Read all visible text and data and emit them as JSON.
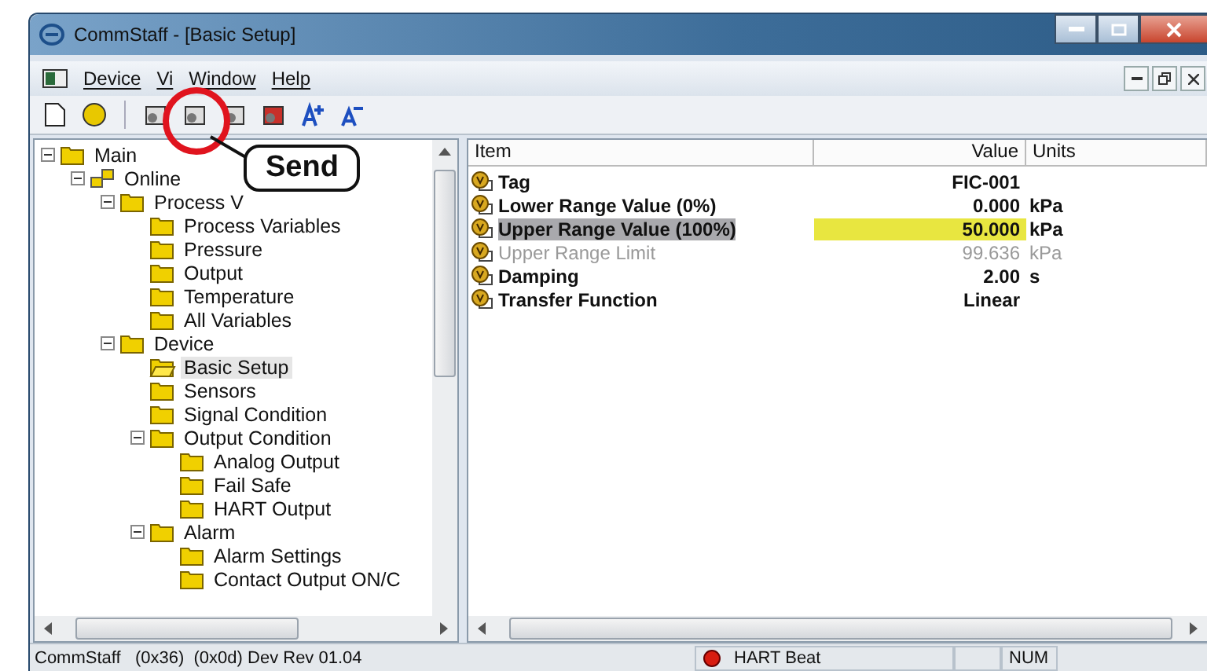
{
  "window": {
    "title": "CommStaff - [Basic Setup]"
  },
  "menu": [
    {
      "label": "Device"
    },
    {
      "label": "Vi"
    },
    {
      "label": "Window"
    },
    {
      "label": "Help"
    }
  ],
  "callout": {
    "label": "Send"
  },
  "tree": [
    {
      "label": "Main",
      "expanded": true,
      "kind": "folder",
      "selected": false,
      "children": [
        {
          "label": "Online",
          "expanded": true,
          "kind": "network",
          "selected": false,
          "children": [
            {
              "label": "Process V",
              "expanded": true,
              "kind": "folder",
              "selected": false,
              "children": [
                {
                  "label": "Process Variables",
                  "kind": "folder",
                  "selected": false
                },
                {
                  "label": "Pressure",
                  "kind": "folder",
                  "selected": false
                },
                {
                  "label": "Output",
                  "kind": "folder",
                  "selected": false
                },
                {
                  "label": "Temperature",
                  "kind": "folder",
                  "selected": false
                },
                {
                  "label": "All Variables",
                  "kind": "folder",
                  "selected": false
                }
              ]
            },
            {
              "label": "Device",
              "expanded": true,
              "kind": "folder",
              "selected": false,
              "children": [
                {
                  "label": "Basic Setup",
                  "kind": "folder",
                  "selected": true
                },
                {
                  "label": "Sensors",
                  "kind": "folder",
                  "selected": false
                },
                {
                  "label": "Signal Condition",
                  "kind": "folder",
                  "selected": false
                },
                {
                  "label": "Output Condition",
                  "expanded": true,
                  "kind": "folder",
                  "selected": false,
                  "children": [
                    {
                      "label": "Analog Output",
                      "kind": "folder",
                      "selected": false
                    },
                    {
                      "label": "Fail Safe",
                      "kind": "folder",
                      "selected": false
                    },
                    {
                      "label": "HART Output",
                      "kind": "folder",
                      "selected": false
                    }
                  ]
                },
                {
                  "label": "Alarm",
                  "expanded": true,
                  "kind": "folder",
                  "selected": false,
                  "children": [
                    {
                      "label": "Alarm Settings",
                      "kind": "folder",
                      "selected": false
                    },
                    {
                      "label": "Contact Output ON/C",
                      "kind": "folder",
                      "selected": false
                    }
                  ]
                }
              ]
            }
          ]
        }
      ]
    }
  ],
  "table": {
    "columns": [
      "Item",
      "Value",
      "Units"
    ],
    "rows": [
      {
        "item": "Tag",
        "value": "FIC-001",
        "selected": false,
        "disabled": false
      },
      {
        "item": "Lower Range Value (0%)",
        "value": "0.000",
        "units": "kPa",
        "selected": false,
        "disabled": false
      },
      {
        "item": "Upper Range Value (100%)",
        "value": "50.000",
        "units": "kPa",
        "selected": true,
        "disabled": false
      },
      {
        "item": "Upper Range Limit",
        "value": "99.636",
        "units": "kPa",
        "selected": false,
        "disabled": true
      },
      {
        "item": "Damping",
        "value": "2.00",
        "units": "s",
        "selected": false,
        "disabled": false
      },
      {
        "item": "Transfer Function",
        "value": "Linear",
        "selected": false,
        "disabled": false
      }
    ]
  },
  "status_bar": {
    "left": "CommStaff   (0x36)  (0x0d) Dev Rev 01.04",
    "heartbeat": "HART Beat",
    "num": "NUM"
  }
}
